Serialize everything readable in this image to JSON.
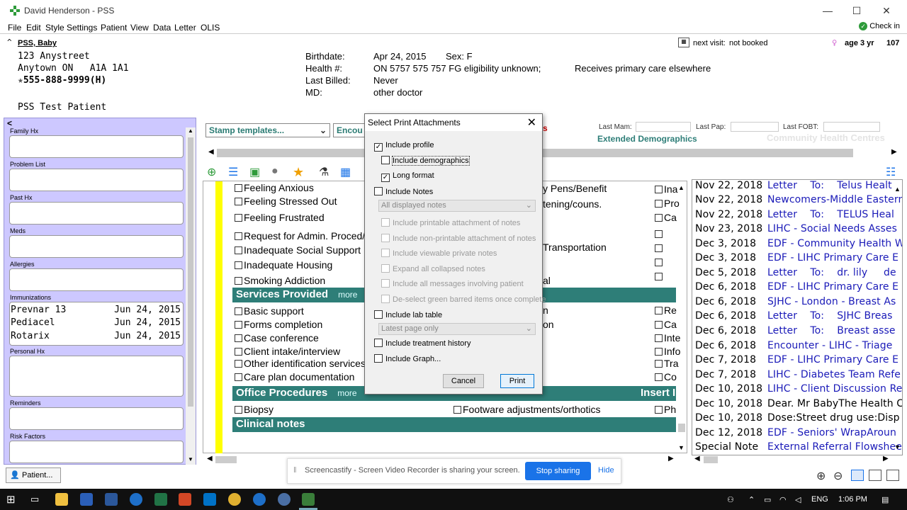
{
  "window": {
    "title": "David Henderson - PSS",
    "minimize": "—",
    "maximize": "☐",
    "close": "✕"
  },
  "menu": {
    "items": [
      "File",
      "Edit",
      "Style",
      "Settings",
      "Patient",
      "View",
      "Data",
      "Letter",
      "OLIS"
    ],
    "check_in": "Check in"
  },
  "patient": {
    "name": "PSS, Baby",
    "address1": "123 Anystreet",
    "address2": "Anytown ON   A1A 1A1",
    "phone": "555-888-9999(H)",
    "note": "PSS Test Patient",
    "birthdate_label": "Birthdate:",
    "birthdate": "Apr 24, 2015",
    "sex": "Sex: F",
    "health_label": "Health #:",
    "health": "ON 5757 575 757 FG eligibility unknown;",
    "care": "Receives primary care elsewhere",
    "billed_label": "Last Billed:",
    "billed": "Never",
    "md_label": "MD:",
    "md": "other doctor",
    "next_visit_label": "next visit:",
    "next_visit": "not booked",
    "age": "age 3 yr",
    "age_num": "107"
  },
  "sidebar": {
    "sections": [
      "Family Hx",
      "Problem List",
      "Past Hx",
      "Meds",
      "Allergies",
      "Immunizations",
      "Personal Hx",
      "Reminders",
      "Risk Factors"
    ],
    "immunizations": [
      {
        "name": "Prevnar 13",
        "date": "Jun 24, 2015"
      },
      {
        "name": "Pediacel",
        "date": "Jun 24, 2015"
      },
      {
        "name": "Rotarix",
        "date": "Jun 24, 2015"
      }
    ],
    "patient_button": "Patient..."
  },
  "main": {
    "stamp_templates": "Stamp templates...",
    "encounter": "Encou",
    "s_label": "s",
    "last_mam": "Last Mam:",
    "last_pap": "Last Pap:",
    "last_fobt": "Last FOBT:",
    "extended_demographics": "Extended Demographics",
    "chc": "Community Health Centres"
  },
  "form": {
    "col1": [
      "Feeling Anxious",
      "Feeling Stressed Out",
      "Feeling Frustrated",
      "Request for Admin. Proced/I",
      "Inadequate Social Support",
      "Inadequate Housing",
      "Smoking Addiction"
    ],
    "col2_partial": [
      "y Pens/Benefit",
      "tening/couns.",
      "Transportation",
      "al"
    ],
    "col3_partial": [
      "Ina",
      "Pro",
      "Ca"
    ],
    "services_title": "Services Provided",
    "more": "more",
    "services": [
      "Basic support",
      "Forms completion",
      "Case conference",
      "Client intake/interview",
      "Other identification services",
      "Care plan documentation"
    ],
    "services_col2": [
      "n",
      "on"
    ],
    "services_col3": [
      "Re",
      "Ca",
      "Inte",
      "Info",
      "Tra",
      "Co"
    ],
    "office_title": "Office Procedures",
    "insert": "Insert I",
    "biopsy": "Biopsy",
    "footware": "Footware adjustments/orthotics",
    "ph": "Ph",
    "clinical_notes": "Clinical notes"
  },
  "notes": [
    {
      "date": "Nov 22, 2018",
      "text": "Letter    To:    Telus Healt",
      "color": "blue"
    },
    {
      "date": "Nov 22, 2018",
      "text": "Newcomers-Middle Eastern",
      "color": "blue"
    },
    {
      "date": "Nov 22, 2018",
      "text": "Letter    To:    TELUS Heal",
      "color": "blue"
    },
    {
      "date": "Nov 23, 2018",
      "text": "LIHC - Social Needs Asses",
      "color": "blue"
    },
    {
      "date": "Dec 3, 2018",
      "text": "EDF - Community Health W",
      "color": "blue"
    },
    {
      "date": "Dec 3, 2018",
      "text": "EDF - LIHC Primary Care E",
      "color": "blue"
    },
    {
      "date": "Dec 5, 2018",
      "text": "Letter    To:    dr. lily     de",
      "color": "blue"
    },
    {
      "date": "Dec 6, 2018",
      "text": "EDF - LIHC Primary Care E",
      "color": "blue"
    },
    {
      "date": "Dec 6, 2018",
      "text": "SJHC - London - Breast As",
      "color": "blue"
    },
    {
      "date": "Dec 6, 2018",
      "text": "Letter    To:    SJHC Breas",
      "color": "blue"
    },
    {
      "date": "Dec 6, 2018",
      "text": "Letter    To:    Breast asse",
      "color": "blue"
    },
    {
      "date": "Dec 6, 2018",
      "text": "Encounter - LIHC - Triage",
      "color": "blue"
    },
    {
      "date": "Dec 7, 2018",
      "text": "EDF - LIHC Primary Care E",
      "color": "blue"
    },
    {
      "date": "Dec 7, 2018",
      "text": "LIHC - Diabetes Team Refe",
      "color": "blue"
    },
    {
      "date": "Dec 10, 2018",
      "text": "LIHC - Client Discussion Re",
      "color": "blue"
    },
    {
      "date": "Dec 10, 2018",
      "text": "Dear. Mr BabyThe Health C",
      "color": "black"
    },
    {
      "date": "Dec 10, 2018",
      "text": "Dose:Street drug use:Disp",
      "color": "black"
    },
    {
      "date": "Dec 12, 2018",
      "text": "EDF - Seniors' WrapAroun",
      "color": "blue"
    },
    {
      "date": "Special Note",
      "text": "External Referral Flowshee",
      "color": "blue"
    }
  ],
  "dialog": {
    "title": "Select Print Attachments",
    "include_profile": "Include profile",
    "include_demographics": "Include demographics",
    "long_format": "Long format",
    "include_notes": "Include Notes",
    "notes_select": "All displayed notes",
    "printable": "Include printable attachment of notes",
    "non_printable": "Include non-printable attachment of notes",
    "viewable_private": "Include viewable private notes",
    "expand_collapsed": "Expand all collapsed notes",
    "all_messages": "Include all messages involving patient",
    "deselect_green": "De-select green barred items once complete",
    "include_lab": "Include lab table",
    "lab_select": "Latest page only",
    "treatment_history": "Include treatment history",
    "include_graph": "Include Graph...",
    "cancel": "Cancel",
    "print": "Print"
  },
  "sharebar": {
    "text": "Screencastify - Screen Video Recorder is sharing your screen.",
    "stop": "Stop sharing",
    "hide": "Hide"
  },
  "taskbar": {
    "lang": "ENG",
    "time": "1:06 PM"
  },
  "colors": {
    "sidebar": "#cdc8ff",
    "section_bar": "#2e7e78",
    "note_blue": "#1a1ab8",
    "highlight": "#ffff00",
    "share_button": "#1a73e8"
  }
}
